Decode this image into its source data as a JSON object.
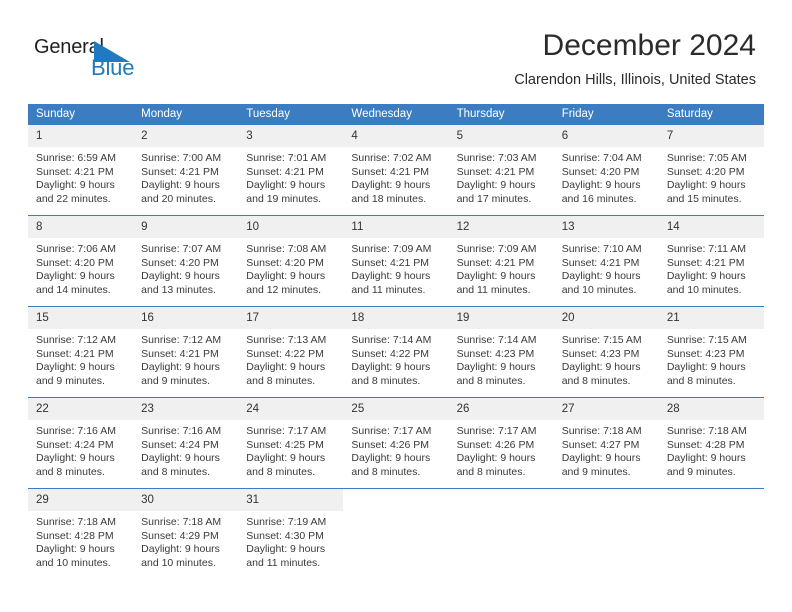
{
  "brand": {
    "name_part1": "General",
    "name_part2": "Blue",
    "accent_color": "#1f7ac0",
    "triangle_icon": "triangle-icon"
  },
  "header": {
    "title": "December 2024",
    "subtitle": "Clarendon Hills, Illinois, United States"
  },
  "calendar": {
    "header_bg": "#3b7dc0",
    "daynum_bg": "#f0f0f0",
    "weekday_headers": [
      "Sunday",
      "Monday",
      "Tuesday",
      "Wednesday",
      "Thursday",
      "Friday",
      "Saturday"
    ],
    "weeks": [
      [
        {
          "day": "1",
          "sunrise": "Sunrise: 6:59 AM",
          "sunset": "Sunset: 4:21 PM",
          "daylight_line1": "Daylight: 9 hours",
          "daylight_line2": "and 22 minutes."
        },
        {
          "day": "2",
          "sunrise": "Sunrise: 7:00 AM",
          "sunset": "Sunset: 4:21 PM",
          "daylight_line1": "Daylight: 9 hours",
          "daylight_line2": "and 20 minutes."
        },
        {
          "day": "3",
          "sunrise": "Sunrise: 7:01 AM",
          "sunset": "Sunset: 4:21 PM",
          "daylight_line1": "Daylight: 9 hours",
          "daylight_line2": "and 19 minutes."
        },
        {
          "day": "4",
          "sunrise": "Sunrise: 7:02 AM",
          "sunset": "Sunset: 4:21 PM",
          "daylight_line1": "Daylight: 9 hours",
          "daylight_line2": "and 18 minutes."
        },
        {
          "day": "5",
          "sunrise": "Sunrise: 7:03 AM",
          "sunset": "Sunset: 4:21 PM",
          "daylight_line1": "Daylight: 9 hours",
          "daylight_line2": "and 17 minutes."
        },
        {
          "day": "6",
          "sunrise": "Sunrise: 7:04 AM",
          "sunset": "Sunset: 4:20 PM",
          "daylight_line1": "Daylight: 9 hours",
          "daylight_line2": "and 16 minutes."
        },
        {
          "day": "7",
          "sunrise": "Sunrise: 7:05 AM",
          "sunset": "Sunset: 4:20 PM",
          "daylight_line1": "Daylight: 9 hours",
          "daylight_line2": "and 15 minutes."
        }
      ],
      [
        {
          "day": "8",
          "sunrise": "Sunrise: 7:06 AM",
          "sunset": "Sunset: 4:20 PM",
          "daylight_line1": "Daylight: 9 hours",
          "daylight_line2": "and 14 minutes."
        },
        {
          "day": "9",
          "sunrise": "Sunrise: 7:07 AM",
          "sunset": "Sunset: 4:20 PM",
          "daylight_line1": "Daylight: 9 hours",
          "daylight_line2": "and 13 minutes."
        },
        {
          "day": "10",
          "sunrise": "Sunrise: 7:08 AM",
          "sunset": "Sunset: 4:20 PM",
          "daylight_line1": "Daylight: 9 hours",
          "daylight_line2": "and 12 minutes."
        },
        {
          "day": "11",
          "sunrise": "Sunrise: 7:09 AM",
          "sunset": "Sunset: 4:21 PM",
          "daylight_line1": "Daylight: 9 hours",
          "daylight_line2": "and 11 minutes."
        },
        {
          "day": "12",
          "sunrise": "Sunrise: 7:09 AM",
          "sunset": "Sunset: 4:21 PM",
          "daylight_line1": "Daylight: 9 hours",
          "daylight_line2": "and 11 minutes."
        },
        {
          "day": "13",
          "sunrise": "Sunrise: 7:10 AM",
          "sunset": "Sunset: 4:21 PM",
          "daylight_line1": "Daylight: 9 hours",
          "daylight_line2": "and 10 minutes."
        },
        {
          "day": "14",
          "sunrise": "Sunrise: 7:11 AM",
          "sunset": "Sunset: 4:21 PM",
          "daylight_line1": "Daylight: 9 hours",
          "daylight_line2": "and 10 minutes."
        }
      ],
      [
        {
          "day": "15",
          "sunrise": "Sunrise: 7:12 AM",
          "sunset": "Sunset: 4:21 PM",
          "daylight_line1": "Daylight: 9 hours",
          "daylight_line2": "and 9 minutes."
        },
        {
          "day": "16",
          "sunrise": "Sunrise: 7:12 AM",
          "sunset": "Sunset: 4:21 PM",
          "daylight_line1": "Daylight: 9 hours",
          "daylight_line2": "and 9 minutes."
        },
        {
          "day": "17",
          "sunrise": "Sunrise: 7:13 AM",
          "sunset": "Sunset: 4:22 PM",
          "daylight_line1": "Daylight: 9 hours",
          "daylight_line2": "and 8 minutes."
        },
        {
          "day": "18",
          "sunrise": "Sunrise: 7:14 AM",
          "sunset": "Sunset: 4:22 PM",
          "daylight_line1": "Daylight: 9 hours",
          "daylight_line2": "and 8 minutes."
        },
        {
          "day": "19",
          "sunrise": "Sunrise: 7:14 AM",
          "sunset": "Sunset: 4:23 PM",
          "daylight_line1": "Daylight: 9 hours",
          "daylight_line2": "and 8 minutes."
        },
        {
          "day": "20",
          "sunrise": "Sunrise: 7:15 AM",
          "sunset": "Sunset: 4:23 PM",
          "daylight_line1": "Daylight: 9 hours",
          "daylight_line2": "and 8 minutes."
        },
        {
          "day": "21",
          "sunrise": "Sunrise: 7:15 AM",
          "sunset": "Sunset: 4:23 PM",
          "daylight_line1": "Daylight: 9 hours",
          "daylight_line2": "and 8 minutes."
        }
      ],
      [
        {
          "day": "22",
          "sunrise": "Sunrise: 7:16 AM",
          "sunset": "Sunset: 4:24 PM",
          "daylight_line1": "Daylight: 9 hours",
          "daylight_line2": "and 8 minutes."
        },
        {
          "day": "23",
          "sunrise": "Sunrise: 7:16 AM",
          "sunset": "Sunset: 4:24 PM",
          "daylight_line1": "Daylight: 9 hours",
          "daylight_line2": "and 8 minutes."
        },
        {
          "day": "24",
          "sunrise": "Sunrise: 7:17 AM",
          "sunset": "Sunset: 4:25 PM",
          "daylight_line1": "Daylight: 9 hours",
          "daylight_line2": "and 8 minutes."
        },
        {
          "day": "25",
          "sunrise": "Sunrise: 7:17 AM",
          "sunset": "Sunset: 4:26 PM",
          "daylight_line1": "Daylight: 9 hours",
          "daylight_line2": "and 8 minutes."
        },
        {
          "day": "26",
          "sunrise": "Sunrise: 7:17 AM",
          "sunset": "Sunset: 4:26 PM",
          "daylight_line1": "Daylight: 9 hours",
          "daylight_line2": "and 8 minutes."
        },
        {
          "day": "27",
          "sunrise": "Sunrise: 7:18 AM",
          "sunset": "Sunset: 4:27 PM",
          "daylight_line1": "Daylight: 9 hours",
          "daylight_line2": "and 9 minutes."
        },
        {
          "day": "28",
          "sunrise": "Sunrise: 7:18 AM",
          "sunset": "Sunset: 4:28 PM",
          "daylight_line1": "Daylight: 9 hours",
          "daylight_line2": "and 9 minutes."
        }
      ],
      [
        {
          "day": "29",
          "sunrise": "Sunrise: 7:18 AM",
          "sunset": "Sunset: 4:28 PM",
          "daylight_line1": "Daylight: 9 hours",
          "daylight_line2": "and 10 minutes."
        },
        {
          "day": "30",
          "sunrise": "Sunrise: 7:18 AM",
          "sunset": "Sunset: 4:29 PM",
          "daylight_line1": "Daylight: 9 hours",
          "daylight_line2": "and 10 minutes."
        },
        {
          "day": "31",
          "sunrise": "Sunrise: 7:19 AM",
          "sunset": "Sunset: 4:30 PM",
          "daylight_line1": "Daylight: 9 hours",
          "daylight_line2": "and 11 minutes."
        },
        {
          "day": "",
          "sunrise": "",
          "sunset": "",
          "daylight_line1": "",
          "daylight_line2": ""
        },
        {
          "day": "",
          "sunrise": "",
          "sunset": "",
          "daylight_line1": "",
          "daylight_line2": ""
        },
        {
          "day": "",
          "sunrise": "",
          "sunset": "",
          "daylight_line1": "",
          "daylight_line2": ""
        },
        {
          "day": "",
          "sunrise": "",
          "sunset": "",
          "daylight_line1": "",
          "daylight_line2": ""
        }
      ]
    ]
  }
}
